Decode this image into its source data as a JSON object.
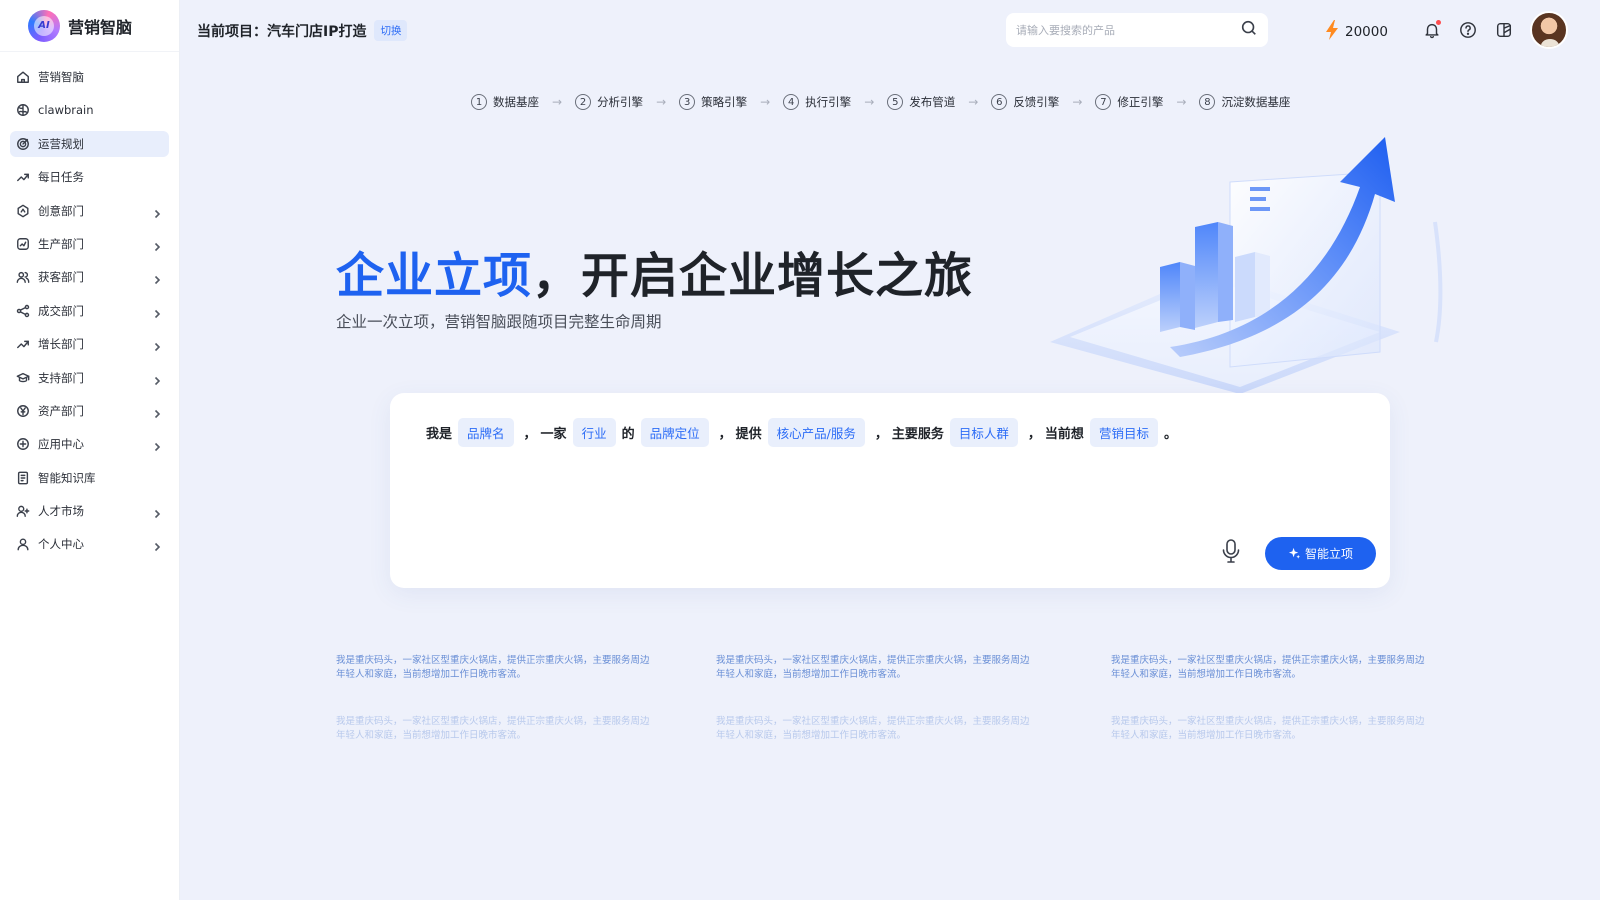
{
  "brand": {
    "logo_text": "AI",
    "name": "营销智脑"
  },
  "sidebar": {
    "items": [
      {
        "label": "营销智脑",
        "icon": "home-icon",
        "chevron": false,
        "active": false
      },
      {
        "label": "clawbrain",
        "icon": "brain-icon",
        "chevron": false,
        "active": false
      },
      {
        "label": "运营规划",
        "icon": "target-icon",
        "chevron": false,
        "active": true
      },
      {
        "label": "每日任务",
        "icon": "trend-icon",
        "chevron": false,
        "active": false
      },
      {
        "label": "创意部门",
        "icon": "bulb-icon",
        "chevron": true,
        "active": false
      },
      {
        "label": "生产部门",
        "icon": "chart-icon",
        "chevron": true,
        "active": false
      },
      {
        "label": "获客部门",
        "icon": "users-icon",
        "chevron": true,
        "active": false
      },
      {
        "label": "成交部门",
        "icon": "share-icon",
        "chevron": true,
        "active": false
      },
      {
        "label": "增长部门",
        "icon": "growth-icon",
        "chevron": true,
        "active": false
      },
      {
        "label": "支持部门",
        "icon": "grad-cap-icon",
        "chevron": true,
        "active": false
      },
      {
        "label": "资产部门",
        "icon": "yen-icon",
        "chevron": true,
        "active": false
      },
      {
        "label": "应用中心",
        "icon": "app-icon",
        "chevron": true,
        "active": false
      },
      {
        "label": "智能知识库",
        "icon": "book-icon",
        "chevron": false,
        "active": false
      },
      {
        "label": "人才市场",
        "icon": "user-plus-icon",
        "chevron": true,
        "active": false
      },
      {
        "label": "个人中心",
        "icon": "user-icon",
        "chevron": true,
        "active": false
      }
    ]
  },
  "header": {
    "project_label": "当前项目：汽车门店IP打造",
    "switch_label": "切换",
    "search_placeholder": "请输入要搜索的产品",
    "credits": "20000"
  },
  "steps": [
    {
      "num": "1",
      "label": "数据基座"
    },
    {
      "num": "2",
      "label": "分析引擎"
    },
    {
      "num": "3",
      "label": "策略引擎"
    },
    {
      "num": "4",
      "label": "执行引擎"
    },
    {
      "num": "5",
      "label": "发布管道"
    },
    {
      "num": "6",
      "label": "反馈引擎"
    },
    {
      "num": "7",
      "label": "修正引擎"
    },
    {
      "num": "8",
      "label": "沉淀数据基座"
    }
  ],
  "step_arrow": "→",
  "hero": {
    "title_accent": "企业立项",
    "title_rest": "，开启企业增长之旅",
    "subtitle": "企业一次立项，营销智脑跟随项目完整生命周期"
  },
  "composer": {
    "t1": "我是",
    "tag_brand": "品牌名",
    "t2": "，",
    "t3": "一家",
    "tag_industry": "行业",
    "t4": "的",
    "tag_position": "品牌定位",
    "t5": "，",
    "t6": "提供",
    "tag_product": "核心产品/服务",
    "t7": "，",
    "t8": "主要服务",
    "tag_audience": "目标人群",
    "t9": "，",
    "t10": "当前想",
    "tag_goal": "营销目标",
    "t11": "。",
    "submit_label": "智能立项"
  },
  "examples": {
    "text": "我是重庆码头，一家社区型重庆火锅店，提供正宗重庆火锅，主要服务周边年轻人和家庭，当前想增加工作日晚市客流。"
  },
  "colors": {
    "accent": "#1e62f0",
    "tag_bg": "#e9effc",
    "background": "#eef1fb"
  }
}
